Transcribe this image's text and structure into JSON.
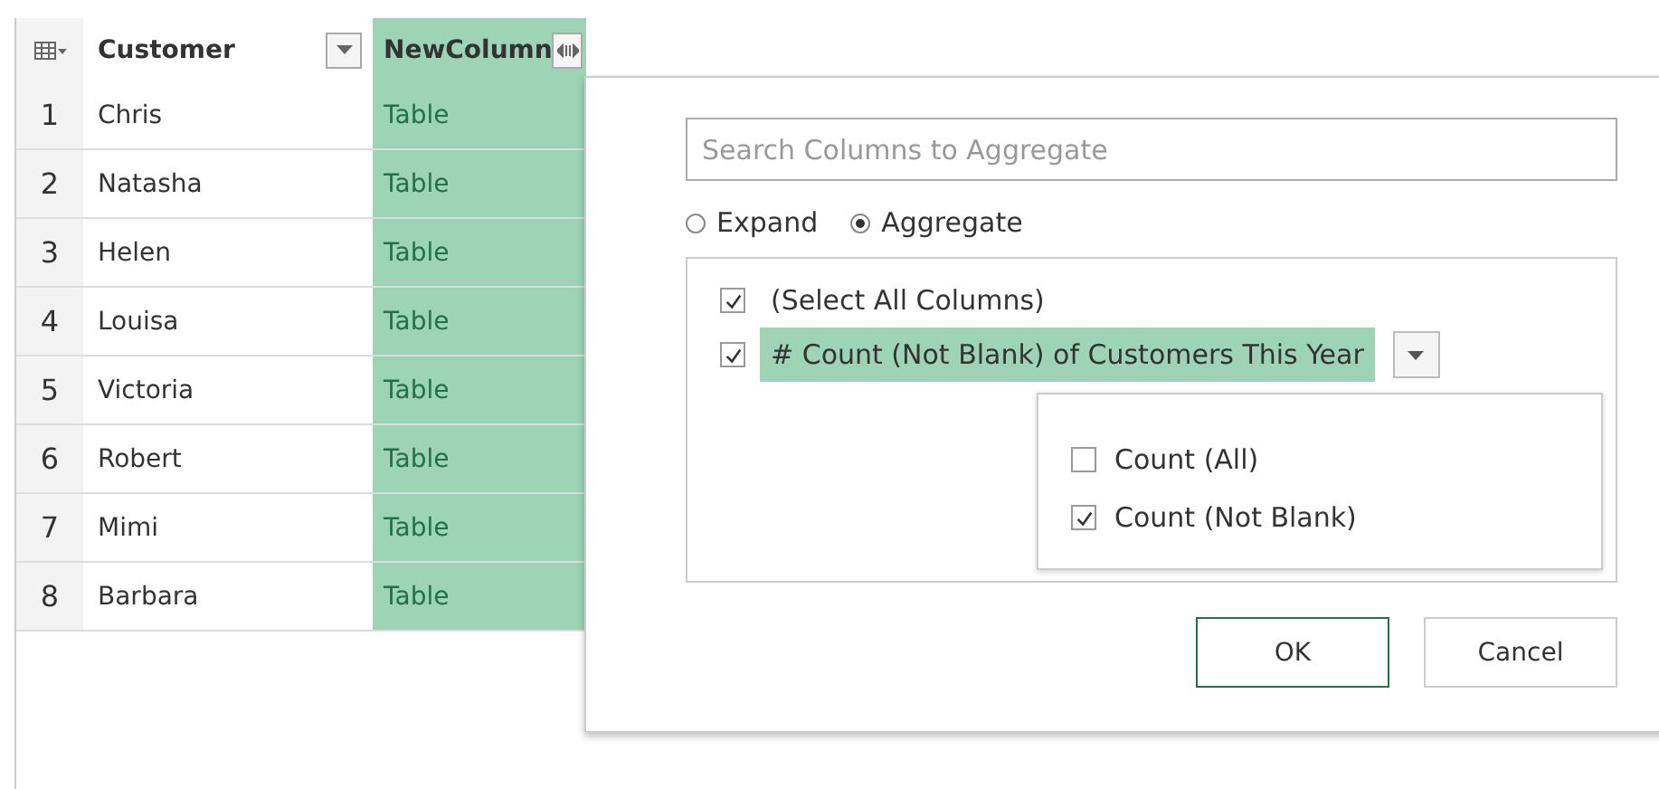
{
  "table": {
    "columns": [
      {
        "label": "Customer",
        "kind": "filter",
        "selected": false
      },
      {
        "label": "NewColumn",
        "kind": "expand",
        "selected": true
      }
    ],
    "rows": [
      {
        "number": "1",
        "cells": [
          "Chris",
          "Table"
        ]
      },
      {
        "number": "2",
        "cells": [
          "Natasha",
          "Table"
        ]
      },
      {
        "number": "3",
        "cells": [
          "Helen",
          "Table"
        ]
      },
      {
        "number": "4",
        "cells": [
          "Louisa",
          "Table"
        ]
      },
      {
        "number": "5",
        "cells": [
          "Victoria",
          "Table"
        ]
      },
      {
        "number": "6",
        "cells": [
          "Robert",
          "Table"
        ]
      },
      {
        "number": "7",
        "cells": [
          "Mimi",
          "Table"
        ]
      },
      {
        "number": "8",
        "cells": [
          "Barbara",
          "Table"
        ]
      }
    ]
  },
  "dialog": {
    "search": {
      "placeholder": "Search Columns to Aggregate"
    },
    "modes": [
      {
        "label": "Expand",
        "selected": false
      },
      {
        "label": "Aggregate",
        "selected": true
      }
    ],
    "columns": [
      {
        "label": "(Select All Columns)",
        "checked": true,
        "selected": false
      },
      {
        "type_symbol": "#",
        "label": "Count (Not Blank) of Customers This Year",
        "checked": true,
        "selected": true
      }
    ],
    "aggregation_menu": {
      "options": [
        {
          "label": "Count (All)",
          "checked": false
        },
        {
          "label": "Count (Not Blank)",
          "checked": true
        }
      ]
    },
    "buttons": [
      {
        "label": "OK",
        "kind": "primary"
      },
      {
        "label": "Cancel",
        "kind": "secondary"
      }
    ]
  }
}
